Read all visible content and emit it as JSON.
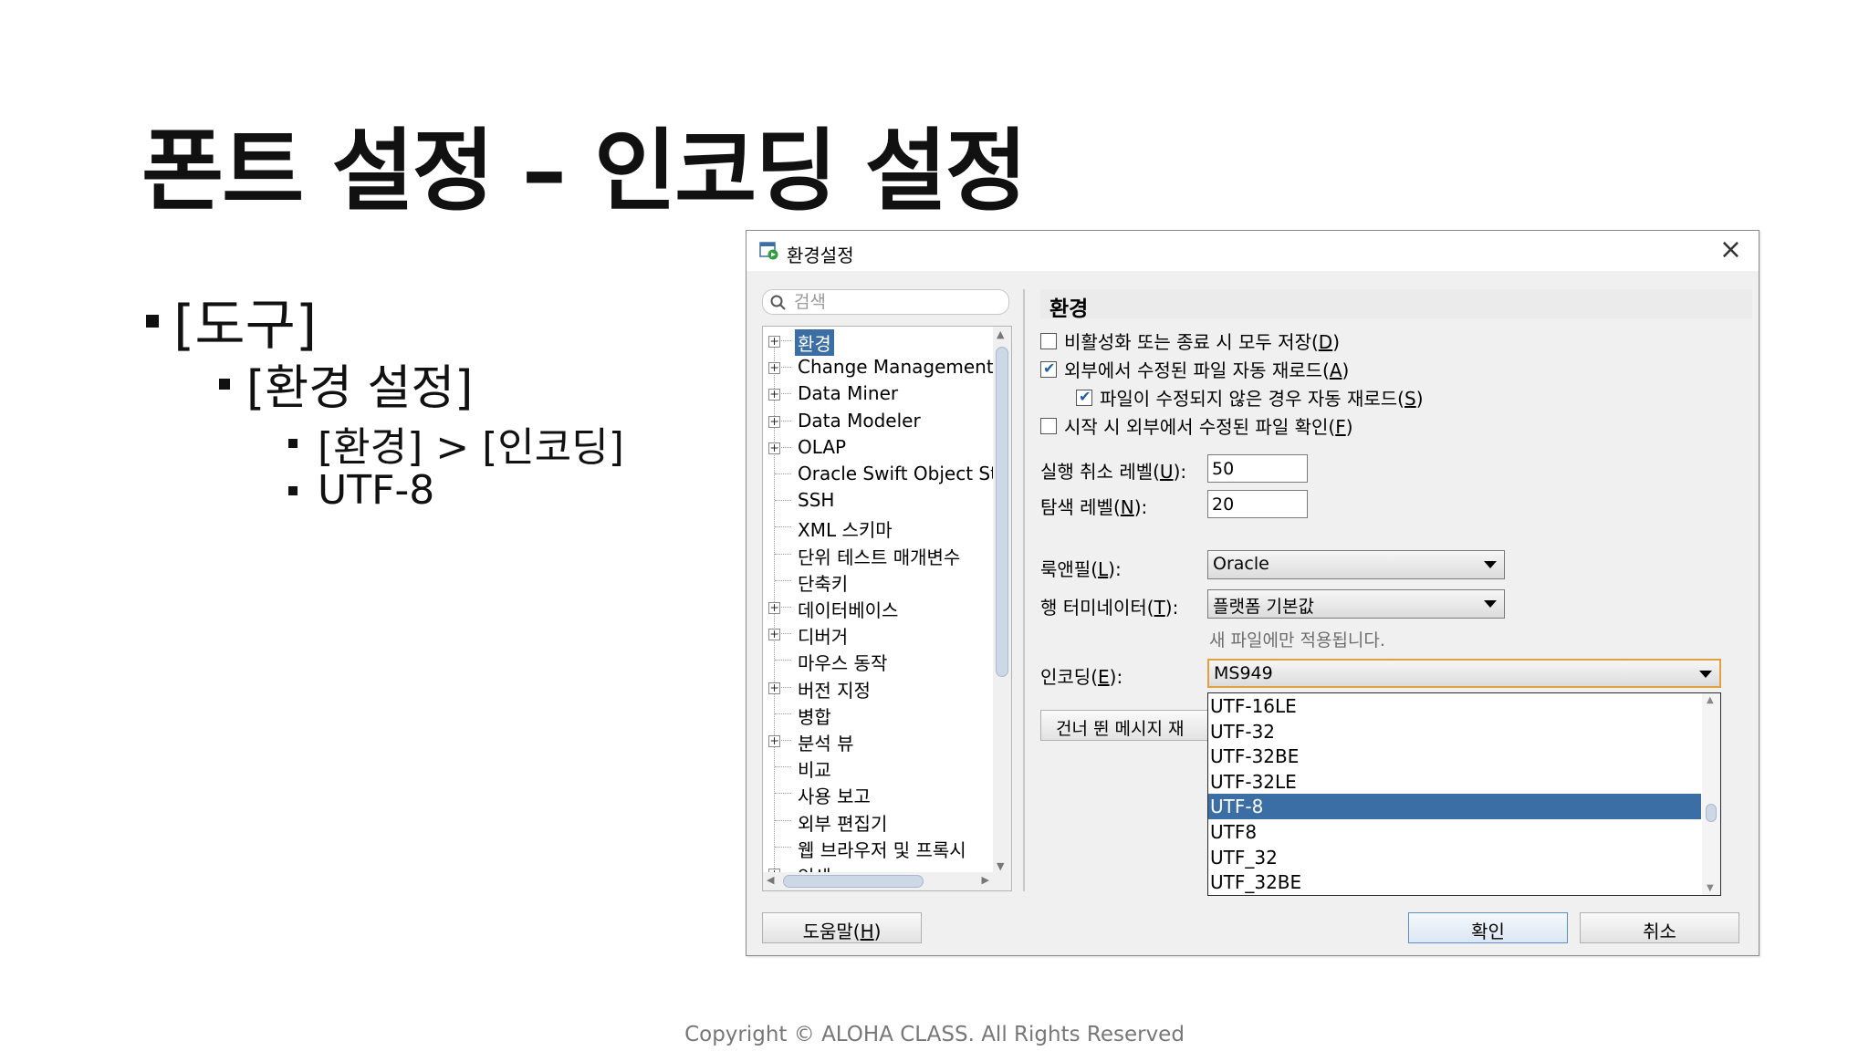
{
  "slide": {
    "title": "폰트 설정 – 인코딩 설정",
    "bullet_1": "[도구]",
    "bullet_2": "[환경 설정]",
    "bullet_3": "[환경] > [인코딩]",
    "bullet_4": "UTF-8",
    "footer": "Copyright © ALOHA CLASS. All Rights Reserved"
  },
  "dialog": {
    "title": "환경설정",
    "search_placeholder": "검색",
    "tree": [
      {
        "label": "환경",
        "expandable": true,
        "selected": true
      },
      {
        "label": "Change Management [",
        "expandable": true
      },
      {
        "label": "Data Miner",
        "expandable": true
      },
      {
        "label": "Data Modeler",
        "expandable": true
      },
      {
        "label": "OLAP",
        "expandable": true
      },
      {
        "label": "Oracle Swift Object Sto",
        "expandable": false
      },
      {
        "label": "SSH",
        "expandable": false
      },
      {
        "label": "XML 스키마",
        "expandable": false
      },
      {
        "label": "단위 테스트 매개변수",
        "expandable": false
      },
      {
        "label": "단축키",
        "expandable": false
      },
      {
        "label": "데이터베이스",
        "expandable": true
      },
      {
        "label": "디버거",
        "expandable": true
      },
      {
        "label": "마우스 동작",
        "expandable": false
      },
      {
        "label": "버전 지정",
        "expandable": true
      },
      {
        "label": "병합",
        "expandable": false
      },
      {
        "label": "분석 뷰",
        "expandable": true
      },
      {
        "label": "비교",
        "expandable": false
      },
      {
        "label": "사용 보고",
        "expandable": false
      },
      {
        "label": "외부 편집기",
        "expandable": false
      },
      {
        "label": "웹 브라우저 및 프록시",
        "expandable": false
      },
      {
        "label": "인쇄",
        "expandable": true
      }
    ],
    "panel": {
      "title": "환경",
      "opt_save_text": "비활성화 또는 종료 시 모두 저장(",
      "opt_save_key": "D",
      "opt_save_checked": false,
      "opt_reload_text": "외부에서 수정된 파일 자동 재로드(",
      "opt_reload_key": "A",
      "opt_reload_checked": true,
      "opt_reload_unmod_text": "파일이 수정되지 않은 경우 자동 재로드(",
      "opt_reload_unmod_key": "S",
      "opt_reload_unmod_checked": true,
      "opt_check_text": "시작 시 외부에서 수정된 파일 확인(",
      "opt_check_key": "F",
      "opt_check_checked": false,
      "close_paren": ")",
      "undo_label": "실행 취소 레벨(",
      "undo_key": "U",
      "undo_suffix": "):",
      "undo_value": "50",
      "nav_label": "탐색 레벨(",
      "nav_key": "N",
      "nav_suffix": "):",
      "nav_value": "20",
      "laf_label": "룩앤필(",
      "laf_key": "L",
      "laf_suffix": "):",
      "laf_value": "Oracle",
      "lineterm_label": "행 터미네이터(",
      "lineterm_key": "T",
      "lineterm_suffix": "):",
      "lineterm_value": "플랫폼 기본값",
      "lineterm_hint": "새 파일에만 적용됩니다.",
      "encoding_label": "인코딩(",
      "encoding_key": "E",
      "encoding_suffix": "):",
      "encoding_value": "MS949",
      "skip_button": "건너 뛴 메시지 재"
    },
    "encoding_options": [
      "UTF-16LE",
      "UTF-32",
      "UTF-32BE",
      "UTF-32LE",
      "UTF-8",
      "UTF8",
      "UTF_32",
      "UTF_32BE"
    ],
    "encoding_highlighted": "UTF-8",
    "help_label": "도움말(",
    "help_key": "H",
    "ok_label": "확인",
    "cancel_label": "취소"
  }
}
